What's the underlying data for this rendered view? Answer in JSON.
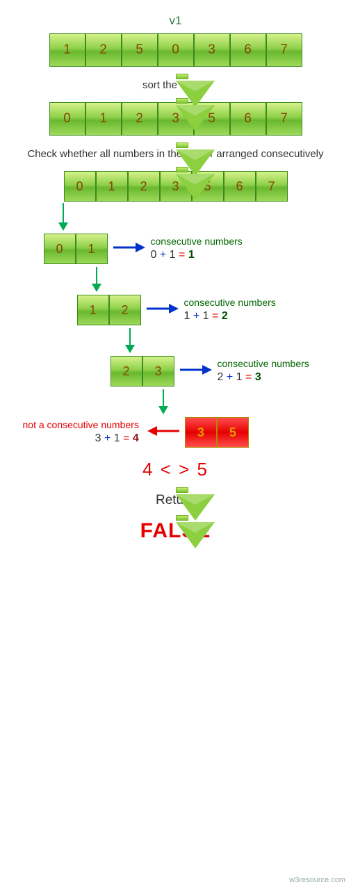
{
  "title": "v1",
  "vectors": {
    "original": [
      "1",
      "2",
      "5",
      "0",
      "3",
      "6",
      "7"
    ],
    "sorted": [
      "0",
      "1",
      "2",
      "3",
      "5",
      "6",
      "7"
    ]
  },
  "captions": {
    "sort": "sort the vector",
    "check": "Check whether all numbers in the vector arranged consecutively"
  },
  "steps": [
    {
      "pair": [
        "0",
        "1"
      ],
      "label": "consecutive numbers",
      "a": "0",
      "op": "+",
      "b": "1",
      "eq": "=",
      "r": "1",
      "ok": true
    },
    {
      "pair": [
        "1",
        "2"
      ],
      "label": "consecutive numbers",
      "a": "1",
      "op": "+",
      "b": "1",
      "eq": "=",
      "r": "2",
      "ok": true
    },
    {
      "pair": [
        "2",
        "3"
      ],
      "label": "consecutive numbers",
      "a": "2",
      "op": "+",
      "b": "1",
      "eq": "=",
      "r": "3",
      "ok": true
    },
    {
      "pair": [
        "3",
        "5"
      ],
      "label": "not a consecutive numbers",
      "a": "3",
      "op": "+",
      "b": "1",
      "eq": "=",
      "r": "4",
      "ok": false
    }
  ],
  "neq": {
    "left": "4",
    "sym": "< >",
    "right": "5"
  },
  "return_label": "Return",
  "result": "FALSE",
  "watermark": "w3resource.com"
}
